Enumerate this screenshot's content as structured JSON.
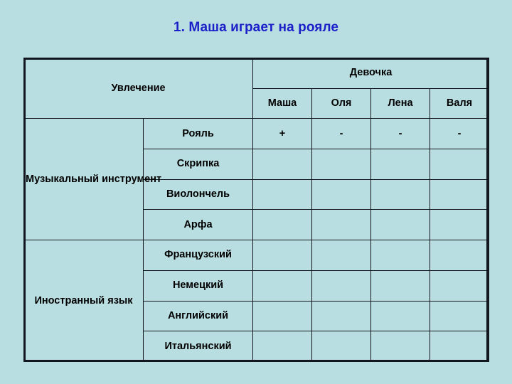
{
  "title": "1. Маша играет на рояле",
  "colors": {
    "background": "#b9dee2",
    "cell_fill": "#b9dee2",
    "border": "#12161f",
    "accent_blue": "#1c20c8",
    "text": "#000000"
  },
  "table": {
    "header": {
      "hobby_label": "Увлечение",
      "girl_label": "Девочка",
      "names": [
        "Маша",
        "Оля",
        "Лена",
        "Валя"
      ]
    },
    "groups": [
      {
        "label": "Музыкальный инструмент",
        "rows": [
          {
            "subject": "Рояль",
            "marks": [
              "+",
              "-",
              "-",
              "-"
            ]
          },
          {
            "subject": "Скрипка",
            "marks": [
              "",
              "",
              "",
              ""
            ]
          },
          {
            "subject": "Виолончель",
            "marks": [
              "",
              "",
              "",
              ""
            ]
          },
          {
            "subject": "Арфа",
            "marks": [
              "",
              "",
              "",
              ""
            ]
          }
        ]
      },
      {
        "label": "Иностранный язык",
        "rows": [
          {
            "subject": "Французский",
            "marks": [
              "",
              "",
              "",
              ""
            ]
          },
          {
            "subject": "Немецкий",
            "marks": [
              "",
              "",
              "",
              ""
            ]
          },
          {
            "subject": "Английский",
            "marks": [
              "",
              "",
              "",
              ""
            ]
          },
          {
            "subject": "Итальянский",
            "marks": [
              "",
              "",
              "",
              ""
            ]
          }
        ]
      }
    ]
  }
}
